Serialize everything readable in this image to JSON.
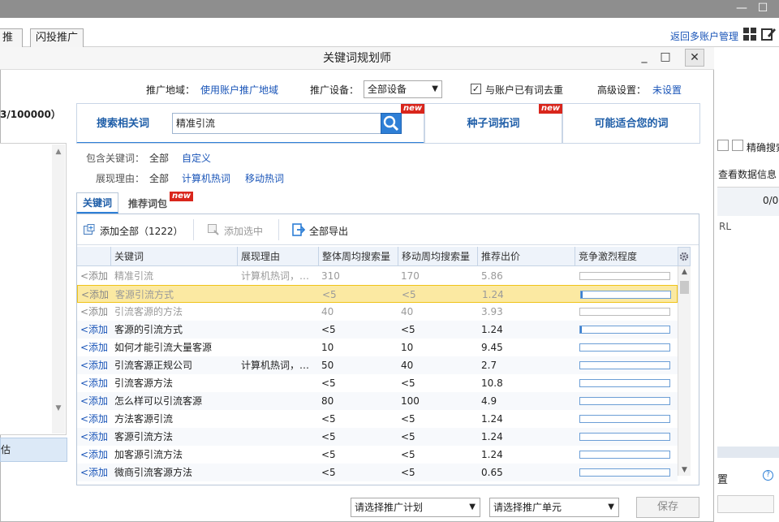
{
  "window": {
    "minimize_glyph": "—",
    "maximize_glyph": "☐"
  },
  "background": {
    "tabs": [
      "推广",
      "闪投推广"
    ],
    "back_link": "返回多账户管理",
    "left_counter": "3/100000）",
    "left_bottom_label": "估",
    "right_exact_search": "精确搜索",
    "right_view_data": "查看数据信息",
    "right_counter": "0/0",
    "right_url": "RL",
    "right_settings": "置"
  },
  "dialog": {
    "title": "关键词规划师",
    "filters": {
      "region_label": "推广地域：",
      "region_value": "使用账户推广地域",
      "device_label": "推广设备：",
      "device_value": "全部设备",
      "dedupe_label": "与账户已有词去重",
      "dedupe_checked": true,
      "advanced_label": "高级设置：",
      "advanced_value": "未设置"
    },
    "search_tabs": [
      {
        "label": "搜索相关词",
        "badge": "new"
      },
      {
        "label": "种子词拓词",
        "badge": "new"
      },
      {
        "label": "可能适合您的词",
        "badge": ""
      }
    ],
    "search_value": "精准引流",
    "include": {
      "label": "包含关键词：",
      "all": "全部",
      "custom": "自定义"
    },
    "reason": {
      "label": "展现理由：",
      "all": "全部",
      "opt1": "计算机热词",
      "opt2": "移动热词"
    },
    "result_tabs": [
      {
        "label": "关键词",
        "badge": ""
      },
      {
        "label": "推荐词包",
        "badge": "new"
      }
    ],
    "toolbar": {
      "add_all": "添加全部（1222）",
      "add_selected": "添加选中",
      "export_all": "全部导出"
    },
    "columns": [
      "关键词",
      "展现理由",
      "整体周均搜索量",
      "移动周均搜索量",
      "推荐出价",
      "竞争激烈程度"
    ],
    "rows": [
      {
        "action": "<添加",
        "keyword": "精准引流",
        "reason": "计算机热词，…",
        "total": "310",
        "mobile": "170",
        "bid": "5.86",
        "competition": 0,
        "state": "added"
      },
      {
        "action": "<添加",
        "keyword": "客源引流方式",
        "reason": "",
        "total": "<5",
        "mobile": "<5",
        "bid": "1.24",
        "competition": 0.02,
        "state": "highlight"
      },
      {
        "action": "<添加",
        "keyword": "引流客源的方法",
        "reason": "",
        "total": "40",
        "mobile": "40",
        "bid": "3.93",
        "competition": 0,
        "state": "added"
      },
      {
        "action": "<添加",
        "keyword": "客源的引流方式",
        "reason": "",
        "total": "<5",
        "mobile": "<5",
        "bid": "1.24",
        "competition": 0.02,
        "state": "normal"
      },
      {
        "action": "<添加",
        "keyword": "如何才能引流大量客源",
        "reason": "",
        "total": "10",
        "mobile": "10",
        "bid": "9.45",
        "competition": 0,
        "state": "normal"
      },
      {
        "action": "<添加",
        "keyword": "引流客源正规公司",
        "reason": "计算机热词，…",
        "total": "50",
        "mobile": "40",
        "bid": "2.7",
        "competition": 0,
        "state": "normal"
      },
      {
        "action": "<添加",
        "keyword": "引流客源方法",
        "reason": "",
        "total": "<5",
        "mobile": "<5",
        "bid": "10.8",
        "competition": 0,
        "state": "normal"
      },
      {
        "action": "<添加",
        "keyword": "怎么样可以引流客源",
        "reason": "",
        "total": "80",
        "mobile": "100",
        "bid": "4.9",
        "competition": 0,
        "state": "normal"
      },
      {
        "action": "<添加",
        "keyword": "方法客源引流",
        "reason": "",
        "total": "<5",
        "mobile": "<5",
        "bid": "1.24",
        "competition": 0,
        "state": "normal"
      },
      {
        "action": "<添加",
        "keyword": "客源引流方法",
        "reason": "",
        "total": "<5",
        "mobile": "<5",
        "bid": "1.24",
        "competition": 0,
        "state": "normal"
      },
      {
        "action": "<添加",
        "keyword": "加客源引流方法",
        "reason": "",
        "total": "<5",
        "mobile": "<5",
        "bid": "1.24",
        "competition": 0,
        "state": "normal"
      },
      {
        "action": "<添加",
        "keyword": "微商引流客源方法",
        "reason": "",
        "total": "<5",
        "mobile": "<5",
        "bid": "0.65",
        "competition": 0,
        "state": "normal"
      }
    ],
    "footer": {
      "plan_placeholder": "请选择推广计划",
      "unit_placeholder": "请选择推广单元",
      "save": "保存"
    }
  },
  "colors": {
    "link": "#1a55b8",
    "highlight_row": "#fbe9a2",
    "badge": "#d9261c",
    "search_button": "#2e7fd6"
  }
}
